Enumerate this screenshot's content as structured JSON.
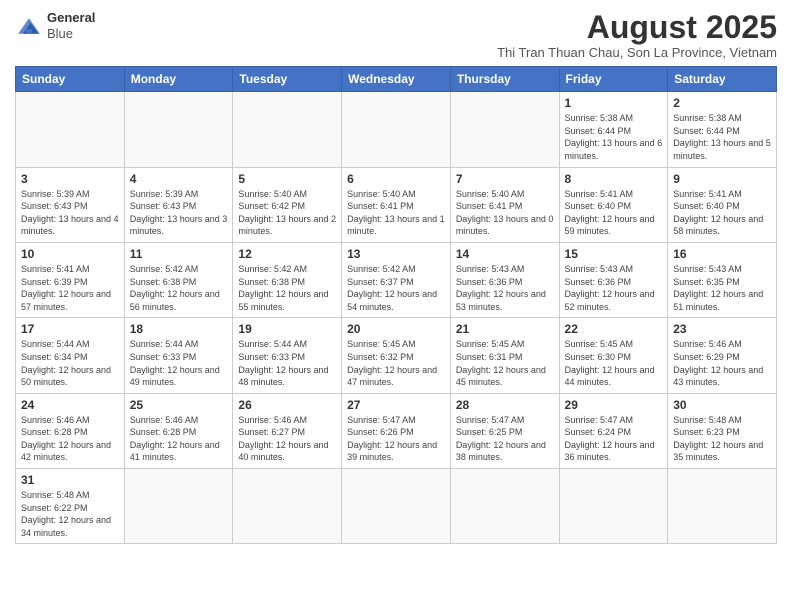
{
  "header": {
    "logo_line1": "General",
    "logo_line2": "Blue",
    "month_title": "August 2025",
    "subtitle": "Thi Tran Thuan Chau, Son La Province, Vietnam"
  },
  "weekdays": [
    "Sunday",
    "Monday",
    "Tuesday",
    "Wednesday",
    "Thursday",
    "Friday",
    "Saturday"
  ],
  "weeks": [
    [
      {
        "day": "",
        "info": ""
      },
      {
        "day": "",
        "info": ""
      },
      {
        "day": "",
        "info": ""
      },
      {
        "day": "",
        "info": ""
      },
      {
        "day": "",
        "info": ""
      },
      {
        "day": "1",
        "info": "Sunrise: 5:38 AM\nSunset: 6:44 PM\nDaylight: 13 hours and 6 minutes."
      },
      {
        "day": "2",
        "info": "Sunrise: 5:38 AM\nSunset: 6:44 PM\nDaylight: 13 hours and 5 minutes."
      }
    ],
    [
      {
        "day": "3",
        "info": "Sunrise: 5:39 AM\nSunset: 6:43 PM\nDaylight: 13 hours and 4 minutes."
      },
      {
        "day": "4",
        "info": "Sunrise: 5:39 AM\nSunset: 6:43 PM\nDaylight: 13 hours and 3 minutes."
      },
      {
        "day": "5",
        "info": "Sunrise: 5:40 AM\nSunset: 6:42 PM\nDaylight: 13 hours and 2 minutes."
      },
      {
        "day": "6",
        "info": "Sunrise: 5:40 AM\nSunset: 6:41 PM\nDaylight: 13 hours and 1 minute."
      },
      {
        "day": "7",
        "info": "Sunrise: 5:40 AM\nSunset: 6:41 PM\nDaylight: 13 hours and 0 minutes."
      },
      {
        "day": "8",
        "info": "Sunrise: 5:41 AM\nSunset: 6:40 PM\nDaylight: 12 hours and 59 minutes."
      },
      {
        "day": "9",
        "info": "Sunrise: 5:41 AM\nSunset: 6:40 PM\nDaylight: 12 hours and 58 minutes."
      }
    ],
    [
      {
        "day": "10",
        "info": "Sunrise: 5:41 AM\nSunset: 6:39 PM\nDaylight: 12 hours and 57 minutes."
      },
      {
        "day": "11",
        "info": "Sunrise: 5:42 AM\nSunset: 6:38 PM\nDaylight: 12 hours and 56 minutes."
      },
      {
        "day": "12",
        "info": "Sunrise: 5:42 AM\nSunset: 6:38 PM\nDaylight: 12 hours and 55 minutes."
      },
      {
        "day": "13",
        "info": "Sunrise: 5:42 AM\nSunset: 6:37 PM\nDaylight: 12 hours and 54 minutes."
      },
      {
        "day": "14",
        "info": "Sunrise: 5:43 AM\nSunset: 6:36 PM\nDaylight: 12 hours and 53 minutes."
      },
      {
        "day": "15",
        "info": "Sunrise: 5:43 AM\nSunset: 6:36 PM\nDaylight: 12 hours and 52 minutes."
      },
      {
        "day": "16",
        "info": "Sunrise: 5:43 AM\nSunset: 6:35 PM\nDaylight: 12 hours and 51 minutes."
      }
    ],
    [
      {
        "day": "17",
        "info": "Sunrise: 5:44 AM\nSunset: 6:34 PM\nDaylight: 12 hours and 50 minutes."
      },
      {
        "day": "18",
        "info": "Sunrise: 5:44 AM\nSunset: 6:33 PM\nDaylight: 12 hours and 49 minutes."
      },
      {
        "day": "19",
        "info": "Sunrise: 5:44 AM\nSunset: 6:33 PM\nDaylight: 12 hours and 48 minutes."
      },
      {
        "day": "20",
        "info": "Sunrise: 5:45 AM\nSunset: 6:32 PM\nDaylight: 12 hours and 47 minutes."
      },
      {
        "day": "21",
        "info": "Sunrise: 5:45 AM\nSunset: 6:31 PM\nDaylight: 12 hours and 45 minutes."
      },
      {
        "day": "22",
        "info": "Sunrise: 5:45 AM\nSunset: 6:30 PM\nDaylight: 12 hours and 44 minutes."
      },
      {
        "day": "23",
        "info": "Sunrise: 5:46 AM\nSunset: 6:29 PM\nDaylight: 12 hours and 43 minutes."
      }
    ],
    [
      {
        "day": "24",
        "info": "Sunrise: 5:46 AM\nSunset: 6:28 PM\nDaylight: 12 hours and 42 minutes."
      },
      {
        "day": "25",
        "info": "Sunrise: 5:46 AM\nSunset: 6:28 PM\nDaylight: 12 hours and 41 minutes."
      },
      {
        "day": "26",
        "info": "Sunrise: 5:46 AM\nSunset: 6:27 PM\nDaylight: 12 hours and 40 minutes."
      },
      {
        "day": "27",
        "info": "Sunrise: 5:47 AM\nSunset: 6:26 PM\nDaylight: 12 hours and 39 minutes."
      },
      {
        "day": "28",
        "info": "Sunrise: 5:47 AM\nSunset: 6:25 PM\nDaylight: 12 hours and 38 minutes."
      },
      {
        "day": "29",
        "info": "Sunrise: 5:47 AM\nSunset: 6:24 PM\nDaylight: 12 hours and 36 minutes."
      },
      {
        "day": "30",
        "info": "Sunrise: 5:48 AM\nSunset: 6:23 PM\nDaylight: 12 hours and 35 minutes."
      }
    ],
    [
      {
        "day": "31",
        "info": "Sunrise: 5:48 AM\nSunset: 6:22 PM\nDaylight: 12 hours and 34 minutes."
      },
      {
        "day": "",
        "info": ""
      },
      {
        "day": "",
        "info": ""
      },
      {
        "day": "",
        "info": ""
      },
      {
        "day": "",
        "info": ""
      },
      {
        "day": "",
        "info": ""
      },
      {
        "day": "",
        "info": ""
      }
    ]
  ]
}
